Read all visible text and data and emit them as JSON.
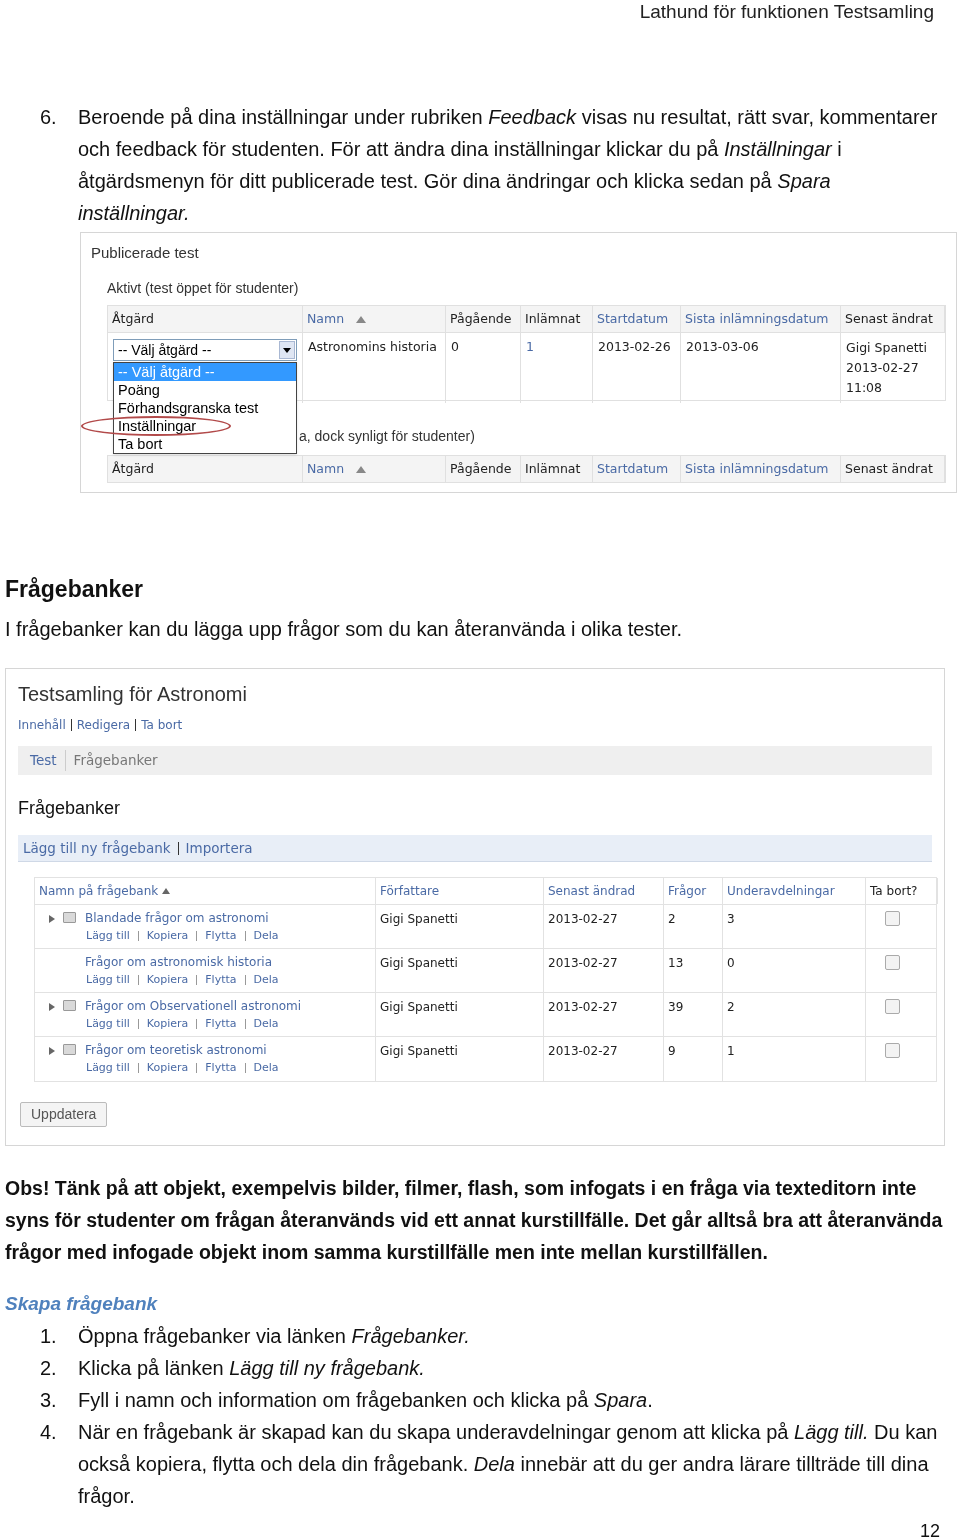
{
  "page_header": "Lathund för funktionen Testsamling",
  "step6": {
    "number": "6.",
    "text": "Beroende på dina inställningar under rubriken *Feedback* visas nu resultat, rätt svar, kommentarer och feedback för studenten. För att ändra dina inställningar klickar du på *Inställningar* i åtgärdsmenyn för ditt publicerade test. Gör dina ändringar och klicka sedan på *Spara inställningar.*"
  },
  "published_screenshot": {
    "title": "Publicerade test",
    "active_heading": "Aktivt (test öppet för studenter)",
    "columns": [
      {
        "label": "Åtgärd",
        "link": false,
        "sorted": false
      },
      {
        "label": "Namn",
        "link": true,
        "sorted": true
      },
      {
        "label": "Pågående",
        "link": false,
        "sorted": false
      },
      {
        "label": "Inlämnat",
        "link": false,
        "sorted": false
      },
      {
        "label": "Startdatum",
        "link": true,
        "sorted": false
      },
      {
        "label": "Sista inlämningsdatum",
        "link": true,
        "sorted": false
      },
      {
        "label": "Senast ändrat",
        "link": false,
        "sorted": false
      }
    ],
    "row": {
      "select_value": "-- Välj åtgärd --",
      "name": "Astronomins historia",
      "in_progress": "0",
      "submitted": "1",
      "start": "2013-02-26",
      "deadline": "2013-03-06",
      "changed": [
        "Gigi Spanetti",
        "2013-02-27",
        "11:08"
      ]
    },
    "dropdown_options": [
      {
        "label": "-- Välj åtgärd --",
        "selected": true,
        "circled": false
      },
      {
        "label": "Poäng",
        "selected": false,
        "circled": false
      },
      {
        "label": "Förhandsgranska test",
        "selected": false,
        "circled": false
      },
      {
        "label": "Inställningar",
        "selected": false,
        "circled": true
      },
      {
        "label": "Ta bort",
        "selected": false,
        "circled": false
      }
    ],
    "inactive_heading": "a, dock synligt för studenter)",
    "inactive_columns": [
      {
        "label": "Åtgärd",
        "link": false,
        "sorted": false
      },
      {
        "label": "Namn",
        "link": true,
        "sorted": true
      },
      {
        "label": "Pågående",
        "link": false,
        "sorted": false
      },
      {
        "label": "Inlämnat",
        "link": false,
        "sorted": false
      },
      {
        "label": "Startdatum",
        "link": true,
        "sorted": false
      },
      {
        "label": "Sista inlämningsdatum",
        "link": true,
        "sorted": false
      },
      {
        "label": "Senast ändrat",
        "link": false,
        "sorted": false
      }
    ]
  },
  "section_heading": "Frågebanker",
  "section_intro": "I frågebanker kan du lägga upp frågor som du kan återanvända i olika tester.",
  "bank_screenshot": {
    "title": "Testsamling för Astronomi",
    "links": [
      "Innehåll",
      "Redigera",
      "Ta bort"
    ],
    "tabs": [
      {
        "label": "Test",
        "selected": false
      },
      {
        "label": "Frågebanker",
        "selected": true
      }
    ],
    "heading": "Frågebanker",
    "actions": [
      "Lägg till ny frågebank",
      "Importera"
    ],
    "columns": [
      {
        "label": "Namn på frågebank",
        "link": true,
        "sorted": true
      },
      {
        "label": "Författare",
        "link": true,
        "sorted": false
      },
      {
        "label": "Senast ändrad",
        "link": true,
        "sorted": false
      },
      {
        "label": "Frågor",
        "link": true,
        "sorted": false
      },
      {
        "label": "Underavdelningar",
        "link": true,
        "sorted": false
      },
      {
        "label": "Ta bort?",
        "link": false,
        "sorted": false
      }
    ],
    "rows": [
      {
        "name": "Blandade frågor om astronomi",
        "expandable": true,
        "actions": [
          "Lägg till",
          "Kopiera",
          "Flytta",
          "Dela"
        ],
        "author": "Gigi Spanetti",
        "changed": "2013-02-27",
        "questions": "2",
        "subsections": "3",
        "checked": false
      },
      {
        "name": "Frågor om astronomisk historia",
        "expandable": false,
        "actions": [
          "Lägg till",
          "Kopiera",
          "Flytta",
          "Dela"
        ],
        "author": "Gigi Spanetti",
        "changed": "2013-02-27",
        "questions": "13",
        "subsections": "0",
        "checked": false
      },
      {
        "name": "Frågor om Observationell astronomi",
        "expandable": true,
        "actions": [
          "Lägg till",
          "Kopiera",
          "Flytta",
          "Dela"
        ],
        "author": "Gigi Spanetti",
        "changed": "2013-02-27",
        "questions": "39",
        "subsections": "2",
        "checked": false
      },
      {
        "name": "Frågor om teoretisk astronomi",
        "expandable": true,
        "actions": [
          "Lägg till",
          "Kopiera",
          "Flytta",
          "Dela"
        ],
        "author": "Gigi Spanetti",
        "changed": "2013-02-27",
        "questions": "9",
        "subsections": "1",
        "checked": false
      }
    ],
    "button": "Uppdatera"
  },
  "note": "Obs! Tänk på att objekt, exempelvis bilder, filmer, flash, som infogats i en fråga via texteditorn inte syns för studenter om frågan återanvänds vid ett annat kurstillfälle. Det går alltså bra att återanvända frågor med infogade objekt inom samma kurstillfälle men inte mellan kurstillfällen.",
  "create_heading": "Skapa frågebank",
  "create_steps": [
    {
      "number": "1.",
      "text": "Öppna frågebanker via länken *Frågebanker.*"
    },
    {
      "number": "2.",
      "text": "Klicka på länken *Lägg till ny frågebank.*"
    },
    {
      "number": "3.",
      "text": "Fyll i namn och information om frågebanken och klicka på *Spara*."
    },
    {
      "number": "4.",
      "text": "När en frågebank är skapad kan du skapa underavdelningar genom att klicka på *Lägg till.* Du kan också kopiera, flytta och dela din frågebank. *Dela* innebär att du ger andra lärare tillträde till dina frågor."
    }
  ],
  "page_number": "12"
}
